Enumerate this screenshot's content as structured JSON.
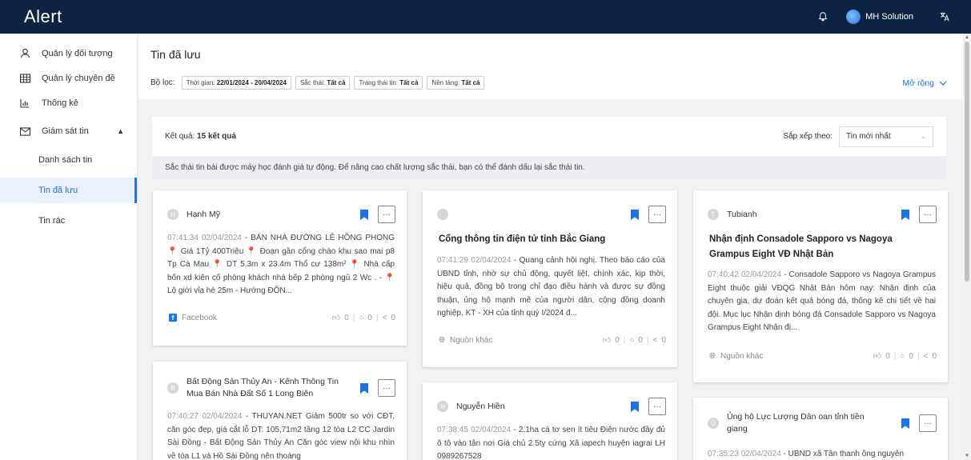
{
  "app": {
    "logo": "Alert"
  },
  "topbar": {
    "user_name": "MH Solution",
    "icons": [
      "bell-icon",
      "avatar",
      "translate-icon"
    ]
  },
  "sidebar": {
    "items": [
      {
        "label": "Quản lý đối tượng",
        "icon": "user-icon"
      },
      {
        "label": "Quản lý chuyên đề",
        "icon": "table-icon"
      },
      {
        "label": "Thống kê",
        "icon": "chart-icon"
      },
      {
        "label": "Giám sát tin",
        "icon": "mail-icon"
      }
    ],
    "sub_items": [
      {
        "label": "Danh sách tin"
      },
      {
        "label": "Tin đã lưu",
        "active": true
      },
      {
        "label": "Tin rác"
      }
    ]
  },
  "page": {
    "title": "Tin đã lưu",
    "filter_label": "Bộ lọc:",
    "filters": [
      {
        "key": "Thời gian:",
        "value": "22/01/2024 - 20/04/2024"
      },
      {
        "key": "Sắc thái:",
        "value": "Tất cả"
      },
      {
        "key": "Trạng thái tin:",
        "value": "Tất cả"
      },
      {
        "key": "Nền tảng:",
        "value": "Tất cả"
      }
    ],
    "expand_label": "Mở rộng"
  },
  "results": {
    "prefix": "Kết quả:",
    "count": "15 kết quả",
    "sort_label": "Sắp xếp theo:",
    "sort_value": "Tin mới nhất",
    "notice": "Sắc thái tin bài được máy học đánh giá tự động. Để nâng cao chất lượng sắc thái, bạn có thể đánh dấu lại sắc thái tin."
  },
  "cards": [
    {
      "avatar": "H",
      "source": "Hạnh Mỹ",
      "title": "",
      "time": "07:41:34 02/04/2024",
      "body": "BÁN NHÀ ĐƯỜNG LÊ HỒNG PHONG 📍 Giá 1Tỷ 400Triệu 📍 Đoạn gần cổng chào khu sao mai p8 Tp Cà Mau 📍 DT 5.3m x 23.4m Thổ cư 138m² 📍 Nhà cấp bốn xd kiên cố phòng khách nhà bếp 2 phòng ngủ 2 Wc . - 📍 Lộ giới vỉa hè 25m - Hướng ĐÔN...",
      "platform": "Facebook",
      "likes": "0",
      "comments": "0",
      "shares": "0"
    },
    {
      "avatar": "",
      "source": "",
      "title": "Cổng thông tin điện tử tỉnh Bắc Giang",
      "time": "07:41:29 02/04/2024",
      "body": "Quang cảnh hội nghị. Theo báo cáo của UBND tỉnh, nhờ sự chủ động, quyết liệt, chính xác, kịp thời, hiệu quả, đồng bộ trong chỉ đạo điều hành và được sự đồng thuận, ủng hộ mạnh mẽ của người dân, cộng đồng doanh nghiệp, KT - XH của tỉnh quý I/2024 đ...",
      "platform": "Nguồn khác",
      "likes": "0",
      "comments": "0",
      "shares": "0"
    },
    {
      "avatar": "T",
      "source": "Tubianh",
      "title": "Nhận định Consadole Sapporo vs Nagoya Grampus Eight VĐ Nhật Bản",
      "time": "07:40:42 02/04/2024",
      "body": "Consadole Sapporo vs Nagoya Grampus Eight thuộc giải VĐQG Nhật Bản hôm nay: Nhận định của chuyên gia, dự đoán kết quả bóng đá, thống kê chi tiết về hai đội. Mục lục Nhận định bóng đá Consadole Sapporo vs Nagoya Grampus Eight Nhận đị...",
      "platform": "Nguồn khác",
      "likes": "0",
      "comments": "0",
      "shares": "0"
    },
    {
      "avatar": "B",
      "source": "Bất Động Sản Thủy An - Kênh Thông Tin Mua Bán Nhà Đất Số 1 Long Biên",
      "title": "",
      "time": "07:40:27 02/04/2024",
      "body": "THUYAN.NET Giảm 500tr so với CĐT, căn góc đẹp, giá cắt lỗ DT: 105,71m2 tầng 12 tòa L2 CC Jardin Sài Đồng - Bất Động Sản Thủy An Căn góc view nội khu nhìn về tòa L1 và Hồ Sài Đồng nên thoáng"
    },
    {
      "avatar": "N",
      "source": "Nguyễn Hiền",
      "title": "",
      "time": "07:38:45 02/04/2024",
      "body": "2.1ha cà tơ sen ít tiêu Điện nước đầy đủ ô tô vào tận nơi Giá chủ 2.5ty cứng Xã iapech huyện iagrai LH 0989267528"
    },
    {
      "avatar": "Ủ",
      "source": "Ủng hộ Lực Lượng Dân oan tỉnh tiền giang",
      "title": "",
      "time": "07:35:23 02/04/2024",
      "body": "UBND xã Tân thanh ông nguyên"
    }
  ]
}
